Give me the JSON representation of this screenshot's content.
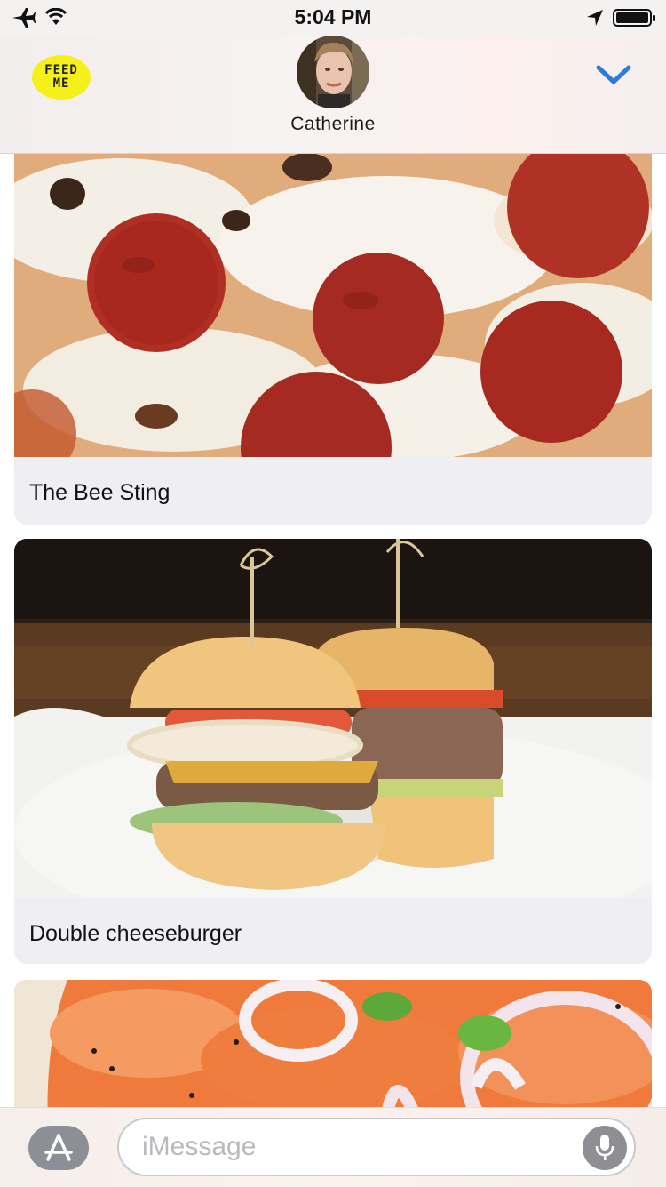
{
  "status_bar": {
    "time": "5:04 PM",
    "icons": [
      "airplane-icon",
      "wifi-icon",
      "location-arrow-icon",
      "battery-icon"
    ]
  },
  "header": {
    "app_badge": {
      "line1": "FEED",
      "line2": "ME"
    },
    "contact_name": "Catherine",
    "accent_color": "#2f7bd9"
  },
  "feed": {
    "items": [
      {
        "title": "The Bee Sting",
        "image": "pepperoni-pizza-photo"
      },
      {
        "title": "Double cheeseburger",
        "image": "cheeseburger-photo"
      },
      {
        "title": "",
        "image": "smoked-salmon-bagel-photo"
      }
    ]
  },
  "composer": {
    "placeholder": "iMessage",
    "app_store_icon": "app-store-icon",
    "mic_icon": "microphone-icon"
  }
}
